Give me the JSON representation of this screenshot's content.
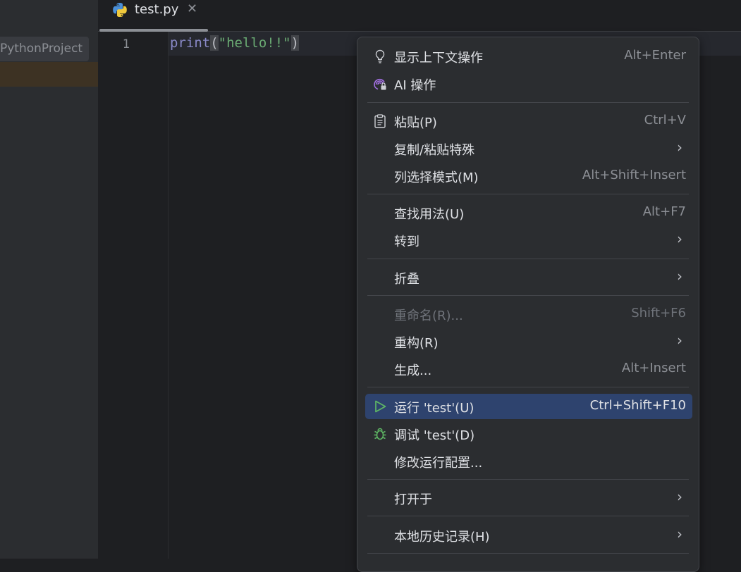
{
  "project": {
    "name": "PythonProject"
  },
  "tab": {
    "filename": "test.py",
    "close": "✕",
    "icon": "python-icon"
  },
  "editor": {
    "line_number": "1",
    "code": {
      "func": "print",
      "open": "(",
      "string": "\"hello!!\"",
      "close": ")"
    }
  },
  "context_menu": {
    "items": [
      {
        "label": "显示上下文操作",
        "shortcut": "Alt+Enter",
        "icon": "lightbulb-icon"
      },
      {
        "label": "AI 操作",
        "shortcut": "",
        "icon": "ai-assistant-icon"
      },
      {
        "label": "粘贴(P)",
        "shortcut": "Ctrl+V",
        "icon": "clipboard-icon"
      },
      {
        "label": "复制/粘贴特殊",
        "submenu": true
      },
      {
        "label": "列选择模式(M)",
        "shortcut": "Alt+Shift+Insert"
      },
      {
        "label": "查找用法(U)",
        "shortcut": "Alt+F7"
      },
      {
        "label": "转到",
        "submenu": true
      },
      {
        "label": "折叠",
        "submenu": true
      },
      {
        "label": "重命名(R)...",
        "shortcut": "Shift+F6",
        "disabled": true
      },
      {
        "label": "重构(R)",
        "submenu": true
      },
      {
        "label": "生成...",
        "shortcut": "Alt+Insert"
      },
      {
        "label": "运行 'test'(U)",
        "shortcut": "Ctrl+Shift+F10",
        "icon": "run-icon",
        "active": true
      },
      {
        "label": "调试 'test'(D)",
        "shortcut": "",
        "icon": "debug-bug-icon"
      },
      {
        "label": "修改运行配置...",
        "shortcut": ""
      },
      {
        "label": "打开于",
        "submenu": true
      },
      {
        "label": "本地历史记录(H)",
        "submenu": true
      }
    ],
    "submenu_arrow": "›"
  },
  "colors": {
    "menu_bg": "#2b2d30",
    "active_bg": "#2e436e",
    "run_green": "#5fb865",
    "ai_purple": "#a571e6"
  }
}
